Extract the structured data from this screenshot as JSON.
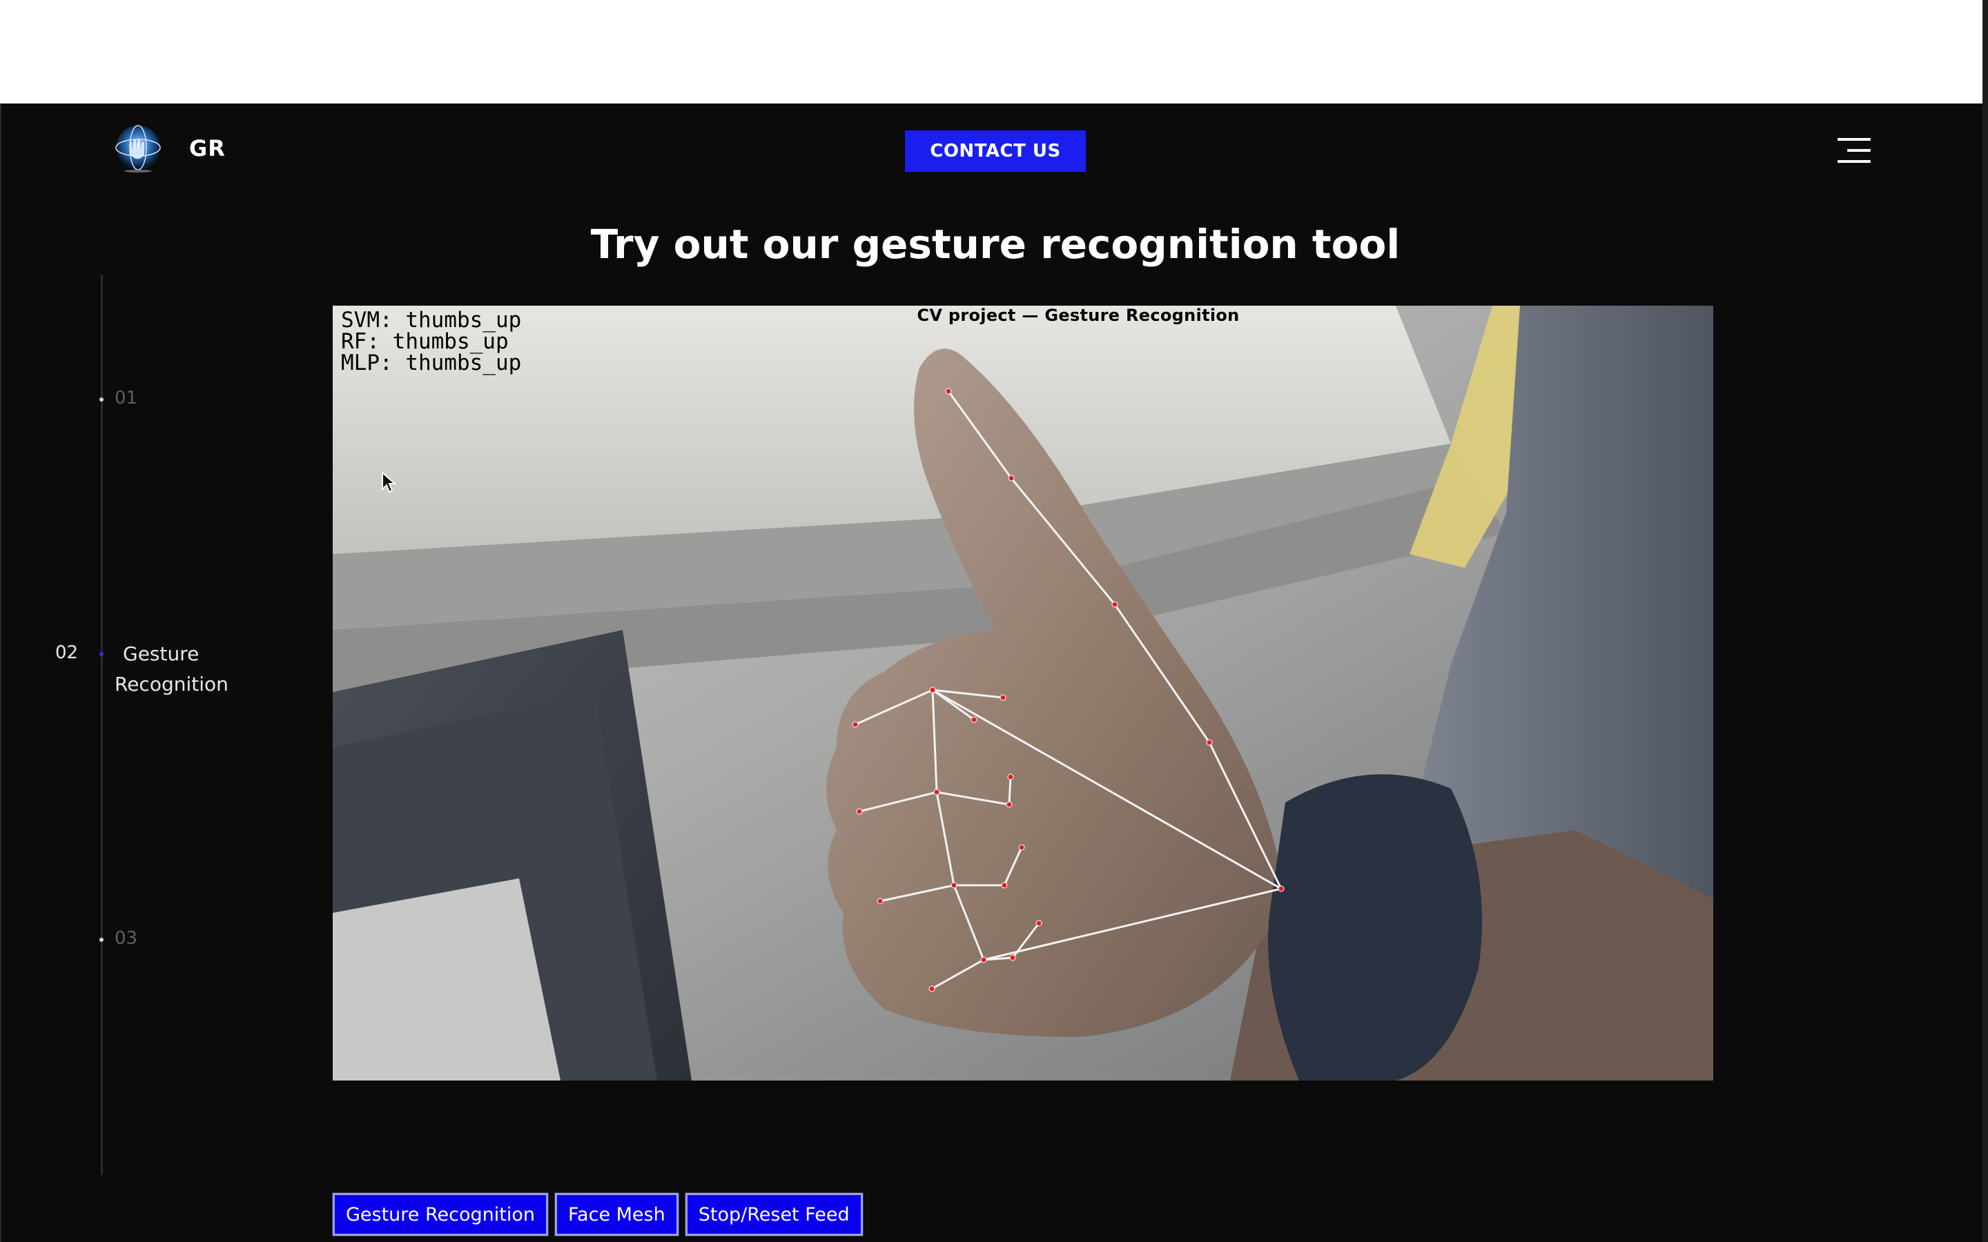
{
  "header": {
    "brand": "GR",
    "contact_label": "CONTACT US"
  },
  "main": {
    "heading": "Try out our gesture recognition tool"
  },
  "side_nav": {
    "items": [
      {
        "number": "01",
        "label": ""
      },
      {
        "number": "02",
        "label": "Gesture Recognition",
        "active": true
      },
      {
        "number": "03",
        "label": ""
      }
    ]
  },
  "feed": {
    "title": "CV project — Gesture Recognition",
    "predictions": [
      "SVM: thumbs_up",
      "RF: thumbs_up",
      "MLP: thumbs_up"
    ]
  },
  "buttons": {
    "gesture_label": "Gesture Recognition",
    "face_mesh_label": "Face Mesh",
    "stop_label": "Stop/Reset Feed"
  },
  "colors": {
    "page_background": "#0b0b0b",
    "accent_blue": "#1a1ff0",
    "button_blue": "#0a00ee",
    "landmark_red": "#e02020"
  },
  "icons": {
    "logo": "hand-globe-logo-icon",
    "menu": "hamburger-menu-icon",
    "cursor": "mouse-pointer-icon"
  }
}
